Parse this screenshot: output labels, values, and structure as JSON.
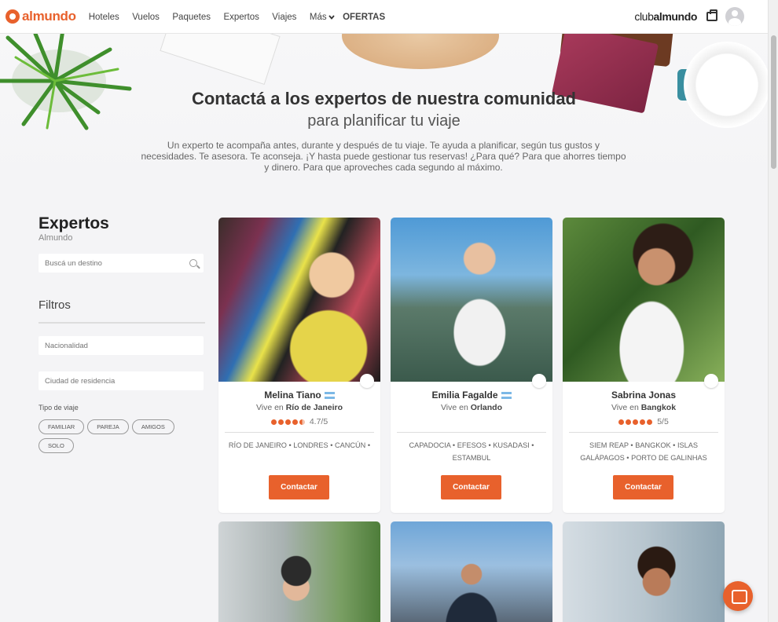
{
  "header": {
    "logo": "almundo",
    "nav": [
      "Hoteles",
      "Vuelos",
      "Paquetes",
      "Expertos",
      "Viajes"
    ],
    "more": "Más",
    "ofertas": "OFERTAS",
    "club_prefix": "club",
    "club_bold": "almundo"
  },
  "hero": {
    "title": "Contactá a los expertos de nuestra comunidad",
    "subtitle": "para planificar tu viaje",
    "description": "Un experto te acompaña antes, durante y después de tu viaje. Te ayuda a planificar, según tus gustos y necesidades. Te asesora. Te aconseja. ¡Y hasta puede gestionar tus reservas! ¿Para qué? Para que ahorres tiempo y dinero. Para que aproveches cada segundo al máximo."
  },
  "sidebar": {
    "title": "Expertos",
    "subtitle": "Almundo",
    "search_placeholder": "Buscá un destino",
    "filters_title": "Filtros",
    "nationality_placeholder": "Nacionalidad",
    "city_placeholder": "Ciudad de residencia",
    "trip_type_label": "Tipo de viaje",
    "chips": [
      "FAMILIAR",
      "PAREJA",
      "AMIGOS",
      "SOLO"
    ]
  },
  "experts": [
    {
      "name": "Melina Tiano",
      "lives_prefix": "Vive en ",
      "city": "Río de Janeiro",
      "rating": "4.7/5",
      "rating_value": 4.7,
      "destinations": "RÍO DE JANEIRO • LONDRES • CANCÚN •",
      "button": "Contactar"
    },
    {
      "name": "Emilia Fagalde",
      "lives_prefix": "Vive en ",
      "city": "Orlando",
      "rating": "",
      "destinations": "CAPADOCIA • EFESOS • KUSADASI • ESTAMBUL",
      "button": "Contactar"
    },
    {
      "name": "Sabrina Jonas",
      "lives_prefix": "Vive en ",
      "city": "Bangkok",
      "rating": "5/5",
      "rating_value": 5,
      "destinations": "SIEM REAP • BANGKOK • ISLAS GALÁPAGOS • PORTO DE GALINHAS",
      "button": "Contactar"
    }
  ],
  "colors": {
    "accent": "#e8612c",
    "background": "#f4f4f6"
  }
}
